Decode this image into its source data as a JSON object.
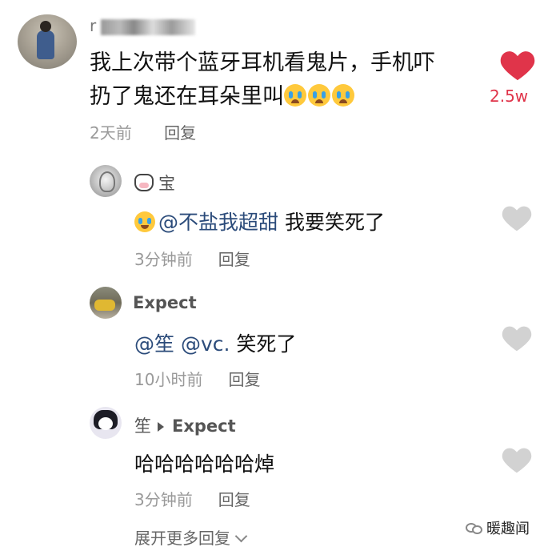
{
  "main_comment": {
    "username_visible": "r",
    "text_line1": "我上次带个蓝牙耳机看鬼片，手机吓",
    "text_line2": "扔了鬼还在耳朵里叫",
    "time": "2天前",
    "reply_label": "回复",
    "like_count": "2.5w",
    "liked": true,
    "like_color": "#e0344a"
  },
  "replies": [
    {
      "username": "宝",
      "mention": "@不盐我超甜",
      "text": " 我要笑死了",
      "time": "3分钟前",
      "reply_label": "回复"
    },
    {
      "username": "Expect",
      "mention": "@笙 @vc.",
      "text": " 笑死了",
      "time": "10小时前",
      "reply_label": "回复"
    },
    {
      "username": "笙",
      "reply_to": "Expect",
      "text": "哈哈哈哈哈哈焯",
      "time": "3分钟前",
      "reply_label": "回复"
    }
  ],
  "expand_label": "展开更多回复",
  "watermark": "暖趣闻"
}
